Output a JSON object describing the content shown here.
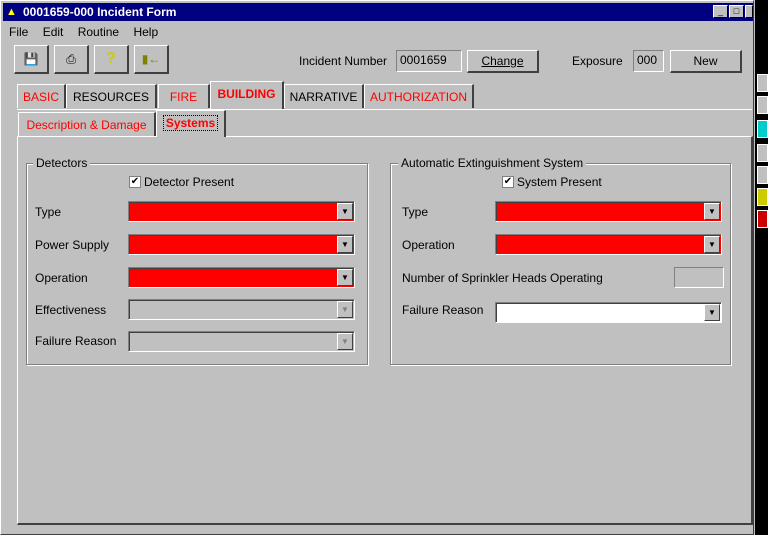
{
  "window": {
    "title": "0001659-000 Incident Form"
  },
  "menu": [
    "File",
    "Edit",
    "Routine",
    "Help"
  ],
  "toolbar": {
    "icons": [
      "save-icon",
      "print-icon",
      "help-icon",
      "exit-icon"
    ]
  },
  "header": {
    "incident_label": "Incident Number",
    "incident_value": "0001659",
    "change_label": "Change",
    "exposure_label": "Exposure",
    "exposure_value": "000",
    "new_label": "New"
  },
  "tabs": [
    {
      "label": "BASIC",
      "color": "#ff0000"
    },
    {
      "label": "RESOURCES",
      "color": "#000000"
    },
    {
      "label": "FIRE",
      "color": "#ff0000"
    },
    {
      "label": "BUILDING",
      "color": "#ff0000",
      "active": true
    },
    {
      "label": "NARRATIVE",
      "color": "#000000"
    },
    {
      "label": "AUTHORIZATION",
      "color": "#ff0000"
    }
  ],
  "subtabs": [
    {
      "label": "Description & Damage"
    },
    {
      "label": "Systems",
      "active": true
    }
  ],
  "detectors": {
    "title": "Detectors",
    "present_label": "Detector Present",
    "present_checked": true,
    "fields": [
      {
        "label": "Type",
        "state": "required"
      },
      {
        "label": "Power Supply",
        "state": "required"
      },
      {
        "label": "Operation",
        "state": "required"
      },
      {
        "label": "Effectiveness",
        "state": "disabled"
      },
      {
        "label": "Failure Reason",
        "state": "disabled"
      }
    ]
  },
  "extinguish": {
    "title": "Automatic Extinguishment System",
    "present_label": "System Present",
    "present_checked": true,
    "type_label": "Type",
    "operation_label": "Operation",
    "sprinkler_label": "Number of Sprinkler Heads Operating",
    "sprinkler_value": "",
    "failure_label": "Failure Reason"
  },
  "colors": {
    "required": "#ff0000",
    "titlebar": "#000080"
  }
}
